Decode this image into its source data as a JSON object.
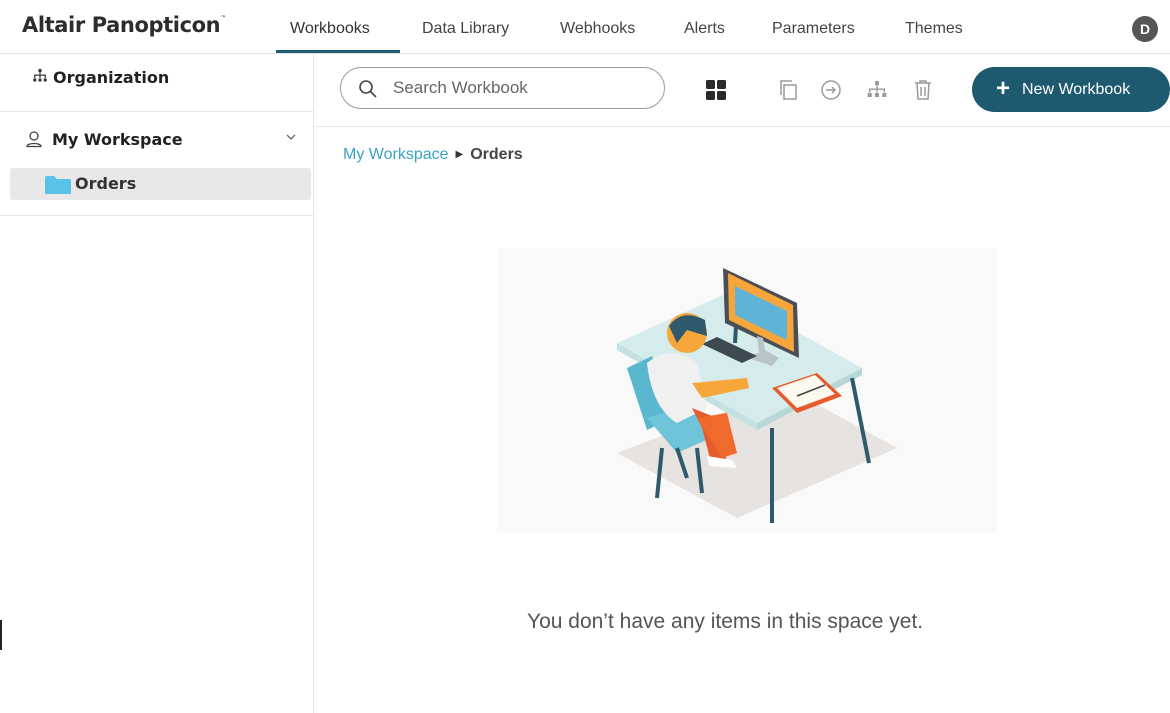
{
  "app": {
    "brand": "Altair Panopticon",
    "brand_tm": "™"
  },
  "nav": {
    "tabs": [
      {
        "label": "Workbooks",
        "active": true
      },
      {
        "label": "Data Library"
      },
      {
        "label": "Webhooks"
      },
      {
        "label": "Alerts"
      },
      {
        "label": "Parameters"
      },
      {
        "label": "Themes"
      }
    ],
    "avatar_initial": "D"
  },
  "sidebar": {
    "organization_label": "Organization",
    "workspace_label": "My Workspace",
    "folder_label": "Orders"
  },
  "toolbar": {
    "search_placeholder": "Search Workbook",
    "new_workbook_label": "New Workbook"
  },
  "breadcrumb": {
    "root": "My Workspace",
    "current": "Orders"
  },
  "main": {
    "empty_message": "You don’t have any items in this space yet."
  },
  "colors": {
    "accent": "#1d5a6f",
    "link": "#3ba2c4",
    "folder": "#5bc2e7"
  },
  "icons": {
    "org": "hierarchy-icon",
    "workspace": "user-icon",
    "folder": "folder-icon",
    "search": "search-icon",
    "grid": "grid-view-icon",
    "copy": "copy-icon",
    "move": "move-icon",
    "hierarchy": "hierarchy-icon",
    "delete": "trash-icon"
  }
}
